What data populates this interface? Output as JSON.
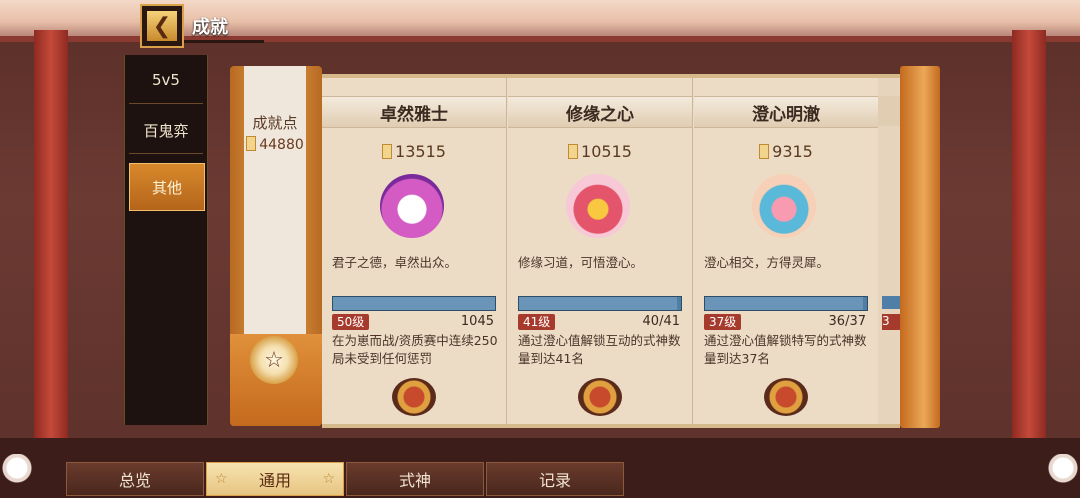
{
  "header": {
    "title": "成就",
    "back_icon": "chevron-left-icon"
  },
  "sidebar": {
    "items": [
      {
        "label": "5v5"
      },
      {
        "label": "百鬼弈"
      },
      {
        "label": "其他",
        "active": true
      }
    ]
  },
  "points_panel": {
    "label": "成就点",
    "value": "44880"
  },
  "cards": [
    {
      "title": "卓然雅士",
      "points": "13515",
      "description": "君子之德，卓然出众。",
      "level": "50级",
      "count": "1045",
      "progress": 1.0,
      "condition": "在为崽而战/资质赛中连续250局未受到任何惩罚"
    },
    {
      "title": "修缘之心",
      "points": "10515",
      "description": "修缘习道，可悟澄心。",
      "level": "41级",
      "count": "40/41",
      "progress": 0.975,
      "condition": "通过澄心值解锁互动的式神数量到达41名"
    },
    {
      "title": "澄心明澈",
      "points": "9315",
      "description": "澄心相交，方得灵犀。",
      "level": "37级",
      "count": "36/37",
      "progress": 0.973,
      "condition": "通过澄心值解锁特写的式神数量到达37名"
    }
  ],
  "partial_card": {
    "level": "3"
  },
  "tabs": [
    {
      "label": "总览"
    },
    {
      "label": "通用",
      "active": true
    },
    {
      "label": "式神"
    },
    {
      "label": "记录"
    }
  ],
  "colors": {
    "accent": "#d8892c",
    "progress": "#4f7ea6",
    "level_badge": "#a63a2c"
  }
}
